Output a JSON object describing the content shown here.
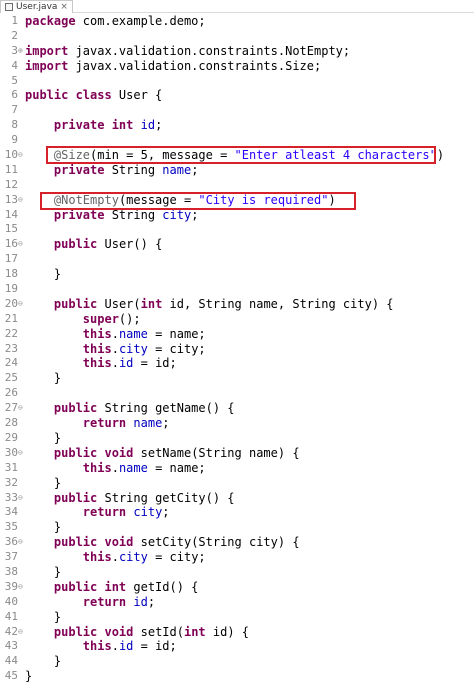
{
  "tab": {
    "title": "User.java",
    "close": "×"
  },
  "lines": [
    {
      "n": "1",
      "fold": "",
      "html": "<span class='kw'>package</span> com.example.demo;"
    },
    {
      "n": "2",
      "fold": "",
      "html": ""
    },
    {
      "n": "3",
      "fold": "⊕",
      "html": "<span class='kw'>import</span> javax.validation.constraints.NotEmpty;"
    },
    {
      "n": "4",
      "fold": "",
      "html": "<span class='kw'>import</span> javax.validation.constraints.Size;"
    },
    {
      "n": "5",
      "fold": "",
      "html": ""
    },
    {
      "n": "6",
      "fold": "",
      "html": "<span class='kw'>public class</span> User {"
    },
    {
      "n": "7",
      "fold": "",
      "html": ""
    },
    {
      "n": "8",
      "fold": "",
      "html": "    <span class='kw'>private int</span> <span class='field'>id</span>;"
    },
    {
      "n": "9",
      "fold": "",
      "html": ""
    },
    {
      "n": "10",
      "fold": "⊖",
      "html": "    <span class='anno'>@Size</span>(min = 5, message = <span class='str'>\"Enter atleast 4 characters\"</span>)"
    },
    {
      "n": "11",
      "fold": "",
      "html": "    <span class='kw'>private</span> String <span class='field'>name</span>;"
    },
    {
      "n": "12",
      "fold": "",
      "html": ""
    },
    {
      "n": "13",
      "fold": "⊖",
      "html": "    <span class='anno'>@NotEmpty</span>(message = <span class='str'>\"City is required\"</span>)"
    },
    {
      "n": "14",
      "fold": "",
      "html": "    <span class='kw'>private</span> String <span class='field'>city</span>;"
    },
    {
      "n": "15",
      "fold": "",
      "html": ""
    },
    {
      "n": "16",
      "fold": "⊖",
      "html": "    <span class='kw'>public</span> User() {"
    },
    {
      "n": "17",
      "fold": "",
      "html": ""
    },
    {
      "n": "18",
      "fold": "",
      "html": "    }"
    },
    {
      "n": "19",
      "fold": "",
      "html": ""
    },
    {
      "n": "20",
      "fold": "⊖",
      "html": "    <span class='kw'>public</span> User(<span class='kw'>int</span> id, String name, String city) {"
    },
    {
      "n": "21",
      "fold": "",
      "html": "        <span class='kw'>super</span>();"
    },
    {
      "n": "22",
      "fold": "",
      "html": "        <span class='kw'>this</span>.<span class='field'>name</span> = name;"
    },
    {
      "n": "23",
      "fold": "",
      "html": "        <span class='kw'>this</span>.<span class='field'>city</span> = city;"
    },
    {
      "n": "24",
      "fold": "",
      "html": "        <span class='kw'>this</span>.<span class='field'>id</span> = id;"
    },
    {
      "n": "25",
      "fold": "",
      "html": "    }"
    },
    {
      "n": "26",
      "fold": "",
      "html": ""
    },
    {
      "n": "27",
      "fold": "⊖",
      "html": "    <span class='kw'>public</span> String getName() {"
    },
    {
      "n": "28",
      "fold": "",
      "html": "        <span class='kw'>return</span> <span class='field'>name</span>;"
    },
    {
      "n": "29",
      "fold": "",
      "html": "    }"
    },
    {
      "n": "30",
      "fold": "⊖",
      "html": "    <span class='kw'>public void</span> setName(String name) {"
    },
    {
      "n": "31",
      "fold": "",
      "html": "        <span class='kw'>this</span>.<span class='field'>name</span> = name;"
    },
    {
      "n": "32",
      "fold": "",
      "html": "    }"
    },
    {
      "n": "33",
      "fold": "⊖",
      "html": "    <span class='kw'>public</span> String getCity() {"
    },
    {
      "n": "34",
      "fold": "",
      "html": "        <span class='kw'>return</span> <span class='field'>city</span>;"
    },
    {
      "n": "35",
      "fold": "",
      "html": "    }"
    },
    {
      "n": "36",
      "fold": "⊖",
      "html": "    <span class='kw'>public void</span> setCity(String city) {"
    },
    {
      "n": "37",
      "fold": "",
      "html": "        <span class='kw'>this</span>.<span class='field'>city</span> = city;"
    },
    {
      "n": "38",
      "fold": "",
      "html": "    }"
    },
    {
      "n": "39",
      "fold": "⊖",
      "html": "    <span class='kw'>public int</span> getId() {"
    },
    {
      "n": "40",
      "fold": "",
      "html": "        <span class='kw'>return</span> <span class='field'>id</span>;"
    },
    {
      "n": "41",
      "fold": "",
      "html": "    }"
    },
    {
      "n": "42",
      "fold": "⊖",
      "html": "    <span class='kw'>public void</span> setId(<span class='kw'>int</span> id) {"
    },
    {
      "n": "43",
      "fold": "",
      "html": "        <span class='kw'>this</span>.<span class='field'>id</span> = id;"
    },
    {
      "n": "44",
      "fold": "",
      "html": "    }"
    },
    {
      "n": "45",
      "fold": "",
      "html": "}"
    }
  ],
  "colors": {
    "keyword": "#7f0055",
    "field": "#0000c0",
    "string": "#2a00ff",
    "annotation": "#646464",
    "highlight_box": "#d6202a"
  }
}
